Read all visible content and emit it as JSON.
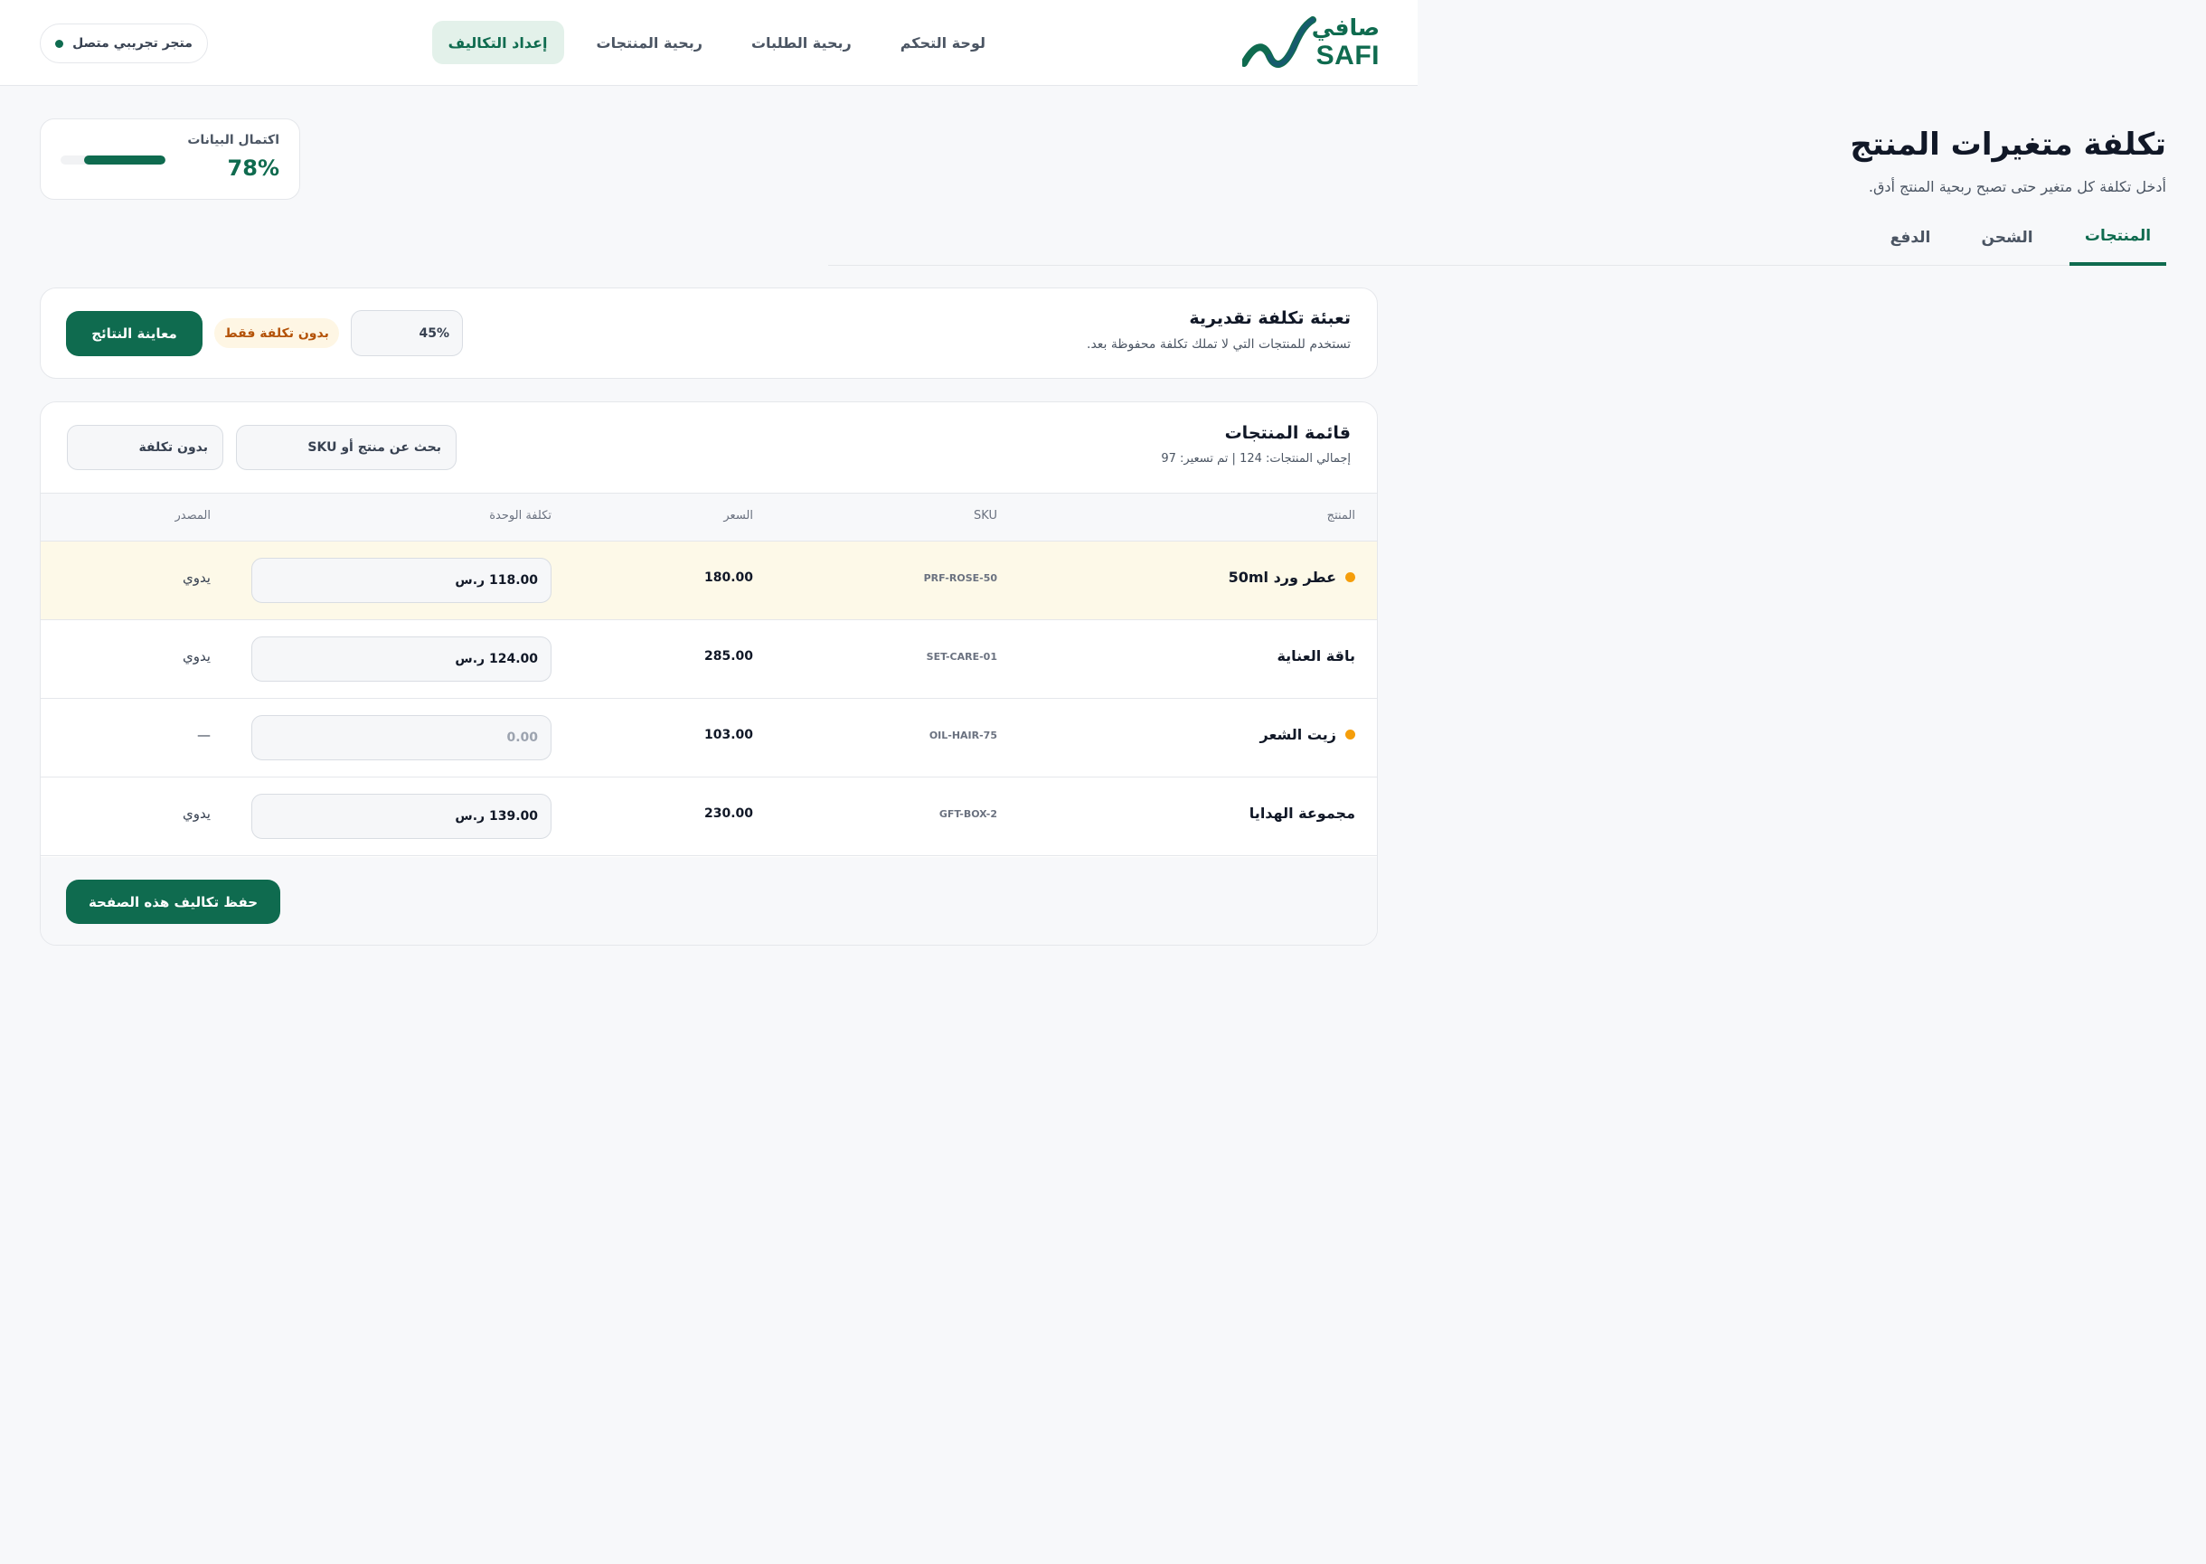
{
  "brand": {
    "name_ar": "صافي",
    "name_en": "SAFI",
    "color": "#0f6b4f"
  },
  "nav": {
    "items": [
      {
        "label": "لوحة التحكم",
        "active": false
      },
      {
        "label": "ربحية الطلبات",
        "active": false
      },
      {
        "label": "ربحية المنتجات",
        "active": false
      },
      {
        "label": "إعداد التكاليف",
        "active": true
      }
    ]
  },
  "store": {
    "label": "متجر تجريبي متصل",
    "status": "connected"
  },
  "page": {
    "title": "تكلفة متغيرات المنتج",
    "subtitle": "أدخل تكلفة كل متغير حتى تصبح ربحية المنتج أدق."
  },
  "completion": {
    "label": "اكتمال البيانات",
    "value": "78%",
    "fraction": 0.78
  },
  "tabs": [
    {
      "label": "المنتجات",
      "active": true
    },
    {
      "label": "الشحن",
      "active": false
    },
    {
      "label": "الدفع",
      "active": false
    }
  ],
  "bulk": {
    "title": "تعبئة تكلفة تقديرية",
    "description": "تستخدم للمنتجات التي لا تملك تكلفة محفوظة بعد.",
    "percent_value": "45%",
    "badge": "بدون تكلفة فقط",
    "preview_label": "معاينة النتائج"
  },
  "products": {
    "title": "قائمة المنتجات",
    "summary": "إجمالي المنتجات: 124 | تم تسعير: 97",
    "search_placeholder": "بحث عن منتج أو SKU",
    "filter_value": "بدون تكلفة",
    "columns": {
      "product": "المنتج",
      "sku": "SKU",
      "price": "السعر",
      "unit_cost": "تكلفة الوحدة",
      "source": "المصدر"
    },
    "rows": [
      {
        "name": "عطر ورد 50ml",
        "sku": "PRF-ROSE-50",
        "price": "180.00",
        "cost": "118.00 ر.س",
        "source": "يدوي",
        "warning": true,
        "highlight": true
      },
      {
        "name": "باقة العناية",
        "sku": "SET-CARE-01",
        "price": "285.00",
        "cost": "124.00 ر.س",
        "source": "يدوي",
        "warning": false,
        "highlight": false
      },
      {
        "name": "زيت الشعر",
        "sku": "OIL-HAIR-75",
        "price": "103.00",
        "cost": "",
        "cost_placeholder": "0.00",
        "source": "—",
        "warning": true,
        "highlight": false
      },
      {
        "name": "مجموعة الهدايا",
        "sku": "GFT-BOX-2",
        "price": "230.00",
        "cost": "139.00 ر.س",
        "source": "يدوي",
        "warning": false,
        "highlight": false
      }
    ],
    "save_label": "حفظ تكاليف هذه الصفحة"
  },
  "colors": {
    "primary": "#0f6b4f",
    "warning": "#f59e0b",
    "highlight_row": "#fdf9e8",
    "badge_bg": "#fef6e4",
    "badge_text": "#b45309"
  },
  "icons": {
    "logo": "safi-swoosh-logo",
    "status": "status-dot-icon",
    "warning": "warning-dot-icon"
  }
}
